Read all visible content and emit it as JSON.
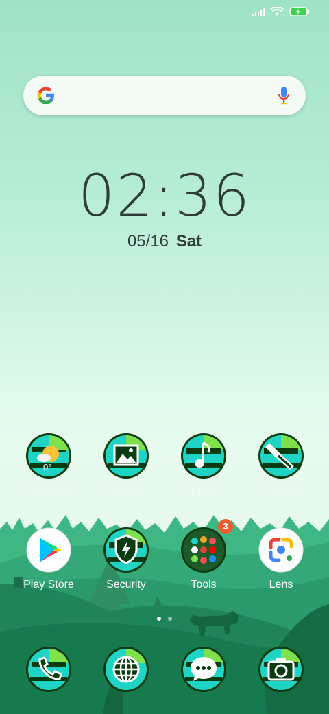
{
  "status_bar": {
    "signal_icon": "signal-bars-icon",
    "wifi_icon": "wifi-icon",
    "battery_icon": "battery-charging-icon"
  },
  "search": {
    "logo": "google-g-icon",
    "mic": "microphone-icon",
    "placeholder": ""
  },
  "clock": {
    "time": "02:36",
    "date": "05/16",
    "day": "Sat"
  },
  "apps_row1": [
    {
      "label": "Weather",
      "icon": "weather-icon",
      "temp": "0°"
    },
    {
      "label": "Gallery",
      "icon": "gallery-icon"
    },
    {
      "label": "Music",
      "icon": "music-icon"
    },
    {
      "label": "Themes",
      "icon": "themes-brush-icon"
    }
  ],
  "apps_row2": [
    {
      "label": "Play Store",
      "icon": "play-store-icon"
    },
    {
      "label": "Security",
      "icon": "security-shield-icon"
    },
    {
      "label": "Tools",
      "icon": "tools-folder-icon",
      "badge": "3"
    },
    {
      "label": "Lens",
      "icon": "lens-icon"
    }
  ],
  "dock": [
    {
      "icon": "phone-icon"
    },
    {
      "icon": "browser-globe-icon"
    },
    {
      "icon": "messages-icon"
    },
    {
      "icon": "camera-icon"
    }
  ],
  "page_indicator": {
    "pages": 2,
    "current": 1
  },
  "colors": {
    "accent": "#1fd4c4",
    "dark_green": "#0b3b10",
    "lime": "#7ee04a",
    "badge": "#f25a2c"
  }
}
